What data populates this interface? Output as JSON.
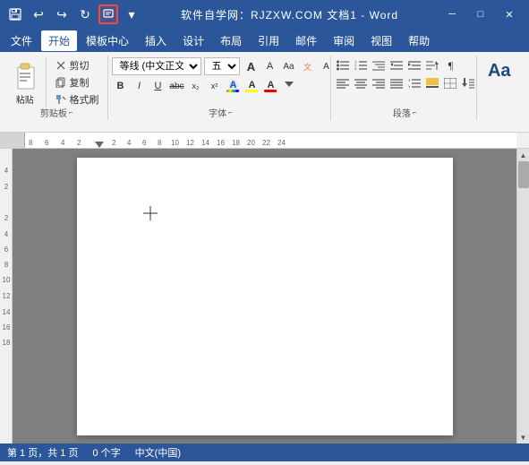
{
  "titlebar": {
    "title": "软件自学网：RJZXW.COM        文档1 - Word",
    "app": "Word",
    "undo_label": "↩",
    "redo_label": "↪",
    "refresh_label": "↻",
    "save_label": "💾",
    "quickaccess_label": "▼"
  },
  "menubar": {
    "items": [
      "文件",
      "开始",
      "模板中心",
      "插入",
      "设计",
      "布局",
      "引用",
      "邮件",
      "审阅",
      "视图",
      "帮助"
    ]
  },
  "ribbon": {
    "clipboard_label": "剪贴板",
    "font_label": "字体",
    "paragraph_label": "段落",
    "paste_label": "粘贴",
    "cut_label": "剪切",
    "copy_label": "复制",
    "format_painter_label": "格式刷",
    "font_name": "等线 (中文正文",
    "font_size": "五号",
    "font_size_up": "A",
    "font_size_down": "A",
    "bold": "B",
    "italic": "I",
    "underline": "U",
    "strikethrough": "abc",
    "subscript": "x₂",
    "superscript": "x²",
    "font_color_label": "A",
    "styles_aa": "Aa"
  },
  "ruler": {
    "marks": [
      "-8",
      "-6",
      "-4",
      "-2",
      "",
      "2",
      "4",
      "6",
      "8",
      "10",
      "12",
      "14",
      "16",
      "18",
      "20",
      "22",
      "24"
    ]
  },
  "statusbar": {
    "page_info": "第 1 页，共 1 页",
    "word_count": "0 个字",
    "language": "中文(中国)"
  }
}
